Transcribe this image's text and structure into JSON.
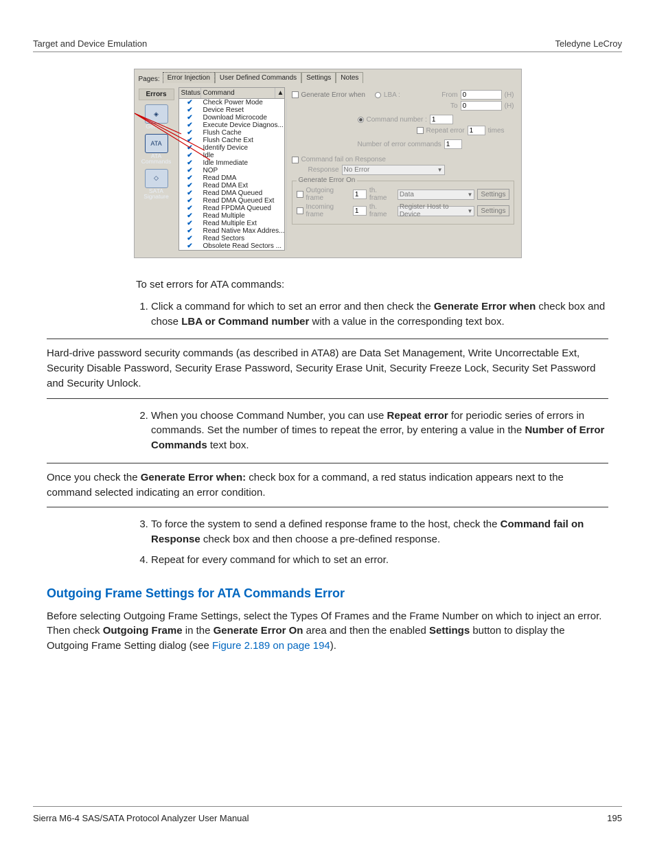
{
  "header": {
    "left": "Target and Device Emulation",
    "right": "Teledyne LeCroy"
  },
  "footer": {
    "left": "Sierra M6-4 SAS/SATA Protocol Analyzer User Manual",
    "right": "195"
  },
  "shot": {
    "pages_label": "Pages:",
    "tabs": [
      "Error Injection",
      "User Defined Commands",
      "Settings",
      "Notes"
    ],
    "sidebar": {
      "title": "Errors",
      "items": [
        {
          "icon": "target-icon",
          "caption": "General"
        },
        {
          "icon": "ata-icon",
          "caption": "ATA Commands",
          "icon_label": "ATA"
        },
        {
          "icon": "sata-icon",
          "caption": "SATA Signature"
        }
      ]
    },
    "cmd_header": {
      "status": "Status",
      "command": "Command",
      "scroll_up": "▲",
      "scroll_down": "▼"
    },
    "commands": [
      "Check Power Mode",
      "Device Reset",
      "Download Microcode",
      "Execute Device Diagnos...",
      "Flush Cache",
      "Flush Cache Ext",
      "Identify Device",
      "Idle",
      "Idle Immediate",
      "NOP",
      "Read DMA",
      "Read DMA Ext",
      "Read DMA Queued",
      "Read DMA Queued Ext",
      "Read FPDMA Queued",
      "Read Multiple",
      "Read Multiple Ext",
      "Read Native Max Addres...",
      "Read Sectors",
      "Obsolete Read Sectors ..."
    ],
    "detail": {
      "gen_err_when": "Generate Error when",
      "lba_label": "LBA :",
      "from_label": "From",
      "to_label": "To",
      "from_val": "0",
      "to_val": "0",
      "hex_suffix": "(H)",
      "cmd_no_label": "Command number :",
      "cmd_no_val": "1",
      "repeat_label": "Repeat error",
      "repeat_val": "1",
      "times_label": "times",
      "num_err_label": "Number of error commands",
      "num_err_val": "1",
      "cfr_label": "Command fail on Response",
      "response_label": "Response",
      "response_val": "No Error",
      "group_title": "Generate Error On",
      "outgoing_label": "Outgoing frame",
      "incoming_label": "Incoming frame",
      "out_val": "1",
      "in_val": "1",
      "th_frame_label": "th. frame",
      "out_sel": "Data",
      "in_sel": "Register Host to Device",
      "settings_btn": "Settings"
    }
  },
  "text": {
    "intro": "To set errors for ATA commands:",
    "s1a": "Click a command for which to set an error and then check the ",
    "s1b": "Generate Error when",
    "s1c": " check box and chose ",
    "s1d": "LBA or Command number",
    "s1e": " with a value in the corresponding text box.",
    "note1": "Hard-drive password security commands (as described in ATA8) are Data Set Management, Write Uncorrectable Ext, Security Disable Password, Security Erase Password, Security Erase Unit, Security Freeze Lock, Security Set Password and Security Unlock.",
    "s2a": "When you choose Command Number, you can use ",
    "s2b": "Repeat error",
    "s2c": " for periodic series of errors in commands. Set the number of times to repeat the error, by entering a value in the ",
    "s2d": "Number of Error Commands",
    "s2e": " text box.",
    "note2a": "Once you check the ",
    "note2b": "Generate Error when:",
    "note2c": " check box for a command, a red status indication appears next to the command selected indicating an error condition.",
    "s3a": "To force the system to send a defined response frame to the host, check the ",
    "s3b": "Command fail on Response",
    "s3c": " check box and then choose a pre-defined response.",
    "s4": "Repeat for every command for which to set an error.",
    "heading": "Outgoing Frame Settings for ATA Commands Error",
    "outA": "Before selecting Outgoing Frame Settings, select the Types Of Frames and the Frame Number on which to inject an error. Then check ",
    "outB": "Outgoing Frame",
    "outC": " in the ",
    "outD": "Generate Error On",
    "outE": " area and then the enabled ",
    "outF": "Settings",
    "outG": " button to display the Outgoing Frame Setting dialog (see ",
    "outLink": "Figure 2.189 on page 194",
    "outH": ")."
  }
}
